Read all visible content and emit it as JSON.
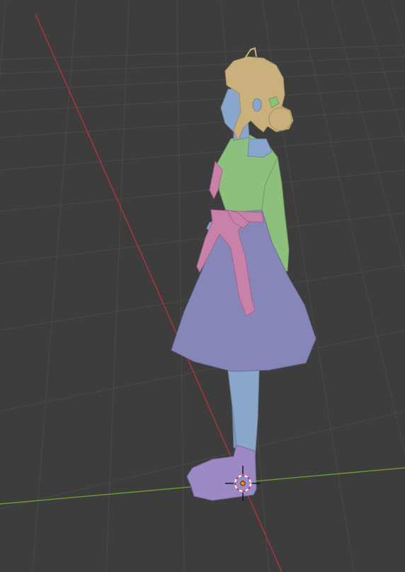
{
  "viewport": {
    "mode": "3d-viewport",
    "shading": "solid-material-color",
    "background_color": "#3d3d3d",
    "grid_color": "#4a4a4a",
    "x_axis_color": "#b0343e",
    "y_axis_color": "#6f9a30"
  },
  "model": {
    "name": "",
    "parts": [
      {
        "part": "hair",
        "color": "#c9b07c"
      },
      {
        "part": "face-skin",
        "color": "#8aa6cc"
      },
      {
        "part": "blouse",
        "color": "#8ec07d"
      },
      {
        "part": "sash",
        "color": "#c881a8"
      },
      {
        "part": "skirt",
        "color": "#8686b8"
      },
      {
        "part": "leg",
        "color": "#8aa6c8"
      },
      {
        "part": "shoe",
        "color": "#9b8ac4"
      }
    ]
  },
  "cursor_3d": {
    "icon": "3d-cursor-icon",
    "color": "#ff8a00"
  }
}
